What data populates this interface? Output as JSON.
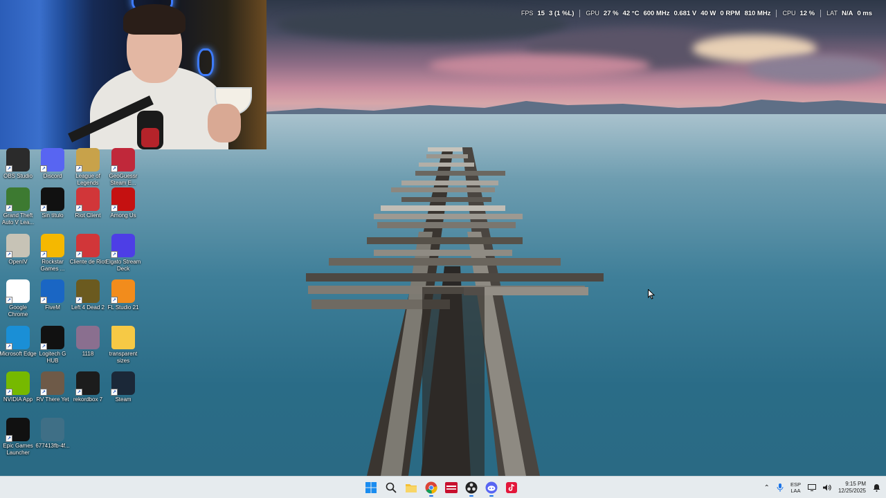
{
  "perf_overlay": {
    "fps": {
      "label": "FPS",
      "value1": "15",
      "value2": "3 (1 %L)"
    },
    "gpu": {
      "label": "GPU",
      "usage": "27 %",
      "temp": "42 °C",
      "clock": "600 MHz",
      "voltage": "0.681 V",
      "power": "40 W",
      "fan": "0 RPM",
      "mem_clock": "810 MHz"
    },
    "cpu": {
      "label": "CPU",
      "usage": "12 %"
    },
    "lat": {
      "label": "LAT",
      "value": "N/A",
      "ms": "0 ms"
    }
  },
  "desktop_icons": [
    {
      "label": "OBS Studio",
      "icon": "obs-icon",
      "color": "#2b2b2b"
    },
    {
      "label": "Discord",
      "icon": "discord-icon",
      "color": "#5865f2"
    },
    {
      "label": "League of Legends",
      "icon": "league-icon",
      "color": "#c8a24a"
    },
    {
      "label": "GeoGuessr Steam E...",
      "icon": "geoguessr-icon",
      "color": "#c0283a"
    },
    {
      "label": "Grand Theft Auto V Lea...",
      "icon": "gta-icon",
      "color": "#3d7a31"
    },
    {
      "label": "Sin título",
      "icon": "file-icon",
      "color": "#111111"
    },
    {
      "label": "Riot Client",
      "icon": "riot-icon",
      "color": "#d13639"
    },
    {
      "label": "Among Us",
      "icon": "among-us-icon",
      "color": "#c51111"
    },
    {
      "label": "OpenIV",
      "icon": "openiv-icon",
      "color": "#c7c3b6"
    },
    {
      "label": "Rockstar Games ...",
      "icon": "rockstar-icon",
      "color": "#f5b800"
    },
    {
      "label": "Cliente de Riot",
      "icon": "riot-icon",
      "color": "#d13639"
    },
    {
      "label": "Elgato Stream Deck",
      "icon": "stream-deck-icon",
      "color": "#4d3ee6"
    },
    {
      "label": "Google Chrome",
      "icon": "chrome-icon",
      "color": "#ffffff"
    },
    {
      "label": "FiveM",
      "icon": "fivem-icon",
      "color": "#1a66c4"
    },
    {
      "label": "Left 4 Dead 2",
      "icon": "left4dead-icon",
      "color": "#6b5a1f"
    },
    {
      "label": "FL Studio 21",
      "icon": "fl-studio-icon",
      "color": "#f28c1c"
    },
    {
      "label": "Microsoft Edge",
      "icon": "edge-icon",
      "color": "#1a8fd6"
    },
    {
      "label": "Logitech G HUB",
      "icon": "logitech-icon",
      "color": "#111111"
    },
    {
      "label": "1118",
      "icon": "image-file-icon",
      "color": "#8a6f8f"
    },
    {
      "label": "transparent sizes",
      "icon": "folder-icon",
      "color": "#f6c945"
    },
    {
      "label": "NVIDIA App",
      "icon": "nvidia-icon",
      "color": "#76b900"
    },
    {
      "label": "RV There Yet",
      "icon": "rv-there-yet-icon",
      "color": "#6e5a48"
    },
    {
      "label": "rekordbox 7",
      "icon": "rekordbox-icon",
      "color": "#1c1c1c"
    },
    {
      "label": "Steam",
      "icon": "steam-icon",
      "color": "#1b2838"
    },
    {
      "label": "Epic Games Launcher",
      "icon": "epic-games-icon",
      "color": "#111111"
    },
    {
      "label": "677413fb-4f...",
      "icon": "image-file-icon",
      "color": "#3f6f86"
    }
  ],
  "taskbar": {
    "pinned": [
      {
        "name": "start",
        "icon": "windows-start-icon"
      },
      {
        "name": "search",
        "icon": "search-icon"
      },
      {
        "name": "file-explorer",
        "icon": "file-explorer-icon"
      },
      {
        "name": "chrome",
        "icon": "chrome-icon"
      },
      {
        "name": "calendar-app",
        "icon": "red-app-icon"
      },
      {
        "name": "obs",
        "icon": "obs-icon"
      },
      {
        "name": "discord",
        "icon": "discord-icon"
      },
      {
        "name": "tiktok",
        "icon": "tiktok-icon"
      }
    ],
    "tray": {
      "language_line1": "ESP",
      "language_line2": "LAA",
      "time": "9:15 PM",
      "date": "12/25/2025"
    },
    "accent": "#1a73e8"
  }
}
